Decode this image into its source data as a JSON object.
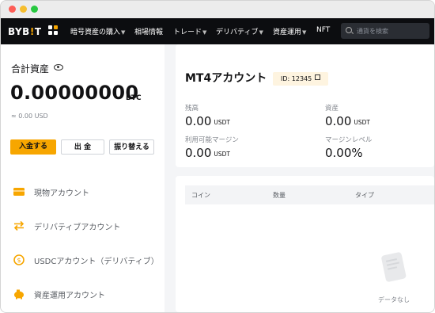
{
  "nav": {
    "logo_main": "BYB",
    "logo_accent": "!",
    "logo_end": "T",
    "items": [
      {
        "label": "暗号資産の購入",
        "caret": true
      },
      {
        "label": "相場情報",
        "caret": false
      },
      {
        "label": "トレード",
        "caret": true
      },
      {
        "label": "デリバティブ",
        "caret": true
      },
      {
        "label": "資産運用",
        "caret": true
      },
      {
        "label": "NFT",
        "caret": false
      }
    ],
    "search_placeholder": "通貨を検索"
  },
  "summary": {
    "title": "合計資産",
    "balance": "0.00000000",
    "unit": "BTC",
    "approx": "≈ 0.00 USD",
    "deposit": "入金する",
    "withdraw": "出 金",
    "transfer": "振り替える"
  },
  "accounts": [
    {
      "label": "現物アカウント",
      "icon": "wallet-icon"
    },
    {
      "label": "デリバティブアカウント",
      "icon": "swap-arrows-icon"
    },
    {
      "label": "USDCアカウント（デリバティブ）",
      "icon": "usdc-coin-icon"
    },
    {
      "label": "資産運用アカウント",
      "icon": "piggy-bank-icon"
    }
  ],
  "mt4": {
    "title": "MT4アカウント",
    "id": "ID: 12345",
    "stats": [
      {
        "label": "残高",
        "value": "0.00",
        "unit": "USDT"
      },
      {
        "label": "資産",
        "value": "0.00",
        "unit": "USDT"
      },
      {
        "label": "利用可能マージン",
        "value": "0.00",
        "unit": "USDT"
      },
      {
        "label": "マージンレベル",
        "value": "0.00%",
        "unit": ""
      }
    ]
  },
  "table": {
    "columns": [
      "コイン",
      "数量",
      "タイプ"
    ],
    "empty_text": "データなし"
  },
  "colors": {
    "accent": "#f7a600",
    "nav_bg": "#0c0d10",
    "text": "#121214",
    "muted": "#81858c"
  }
}
